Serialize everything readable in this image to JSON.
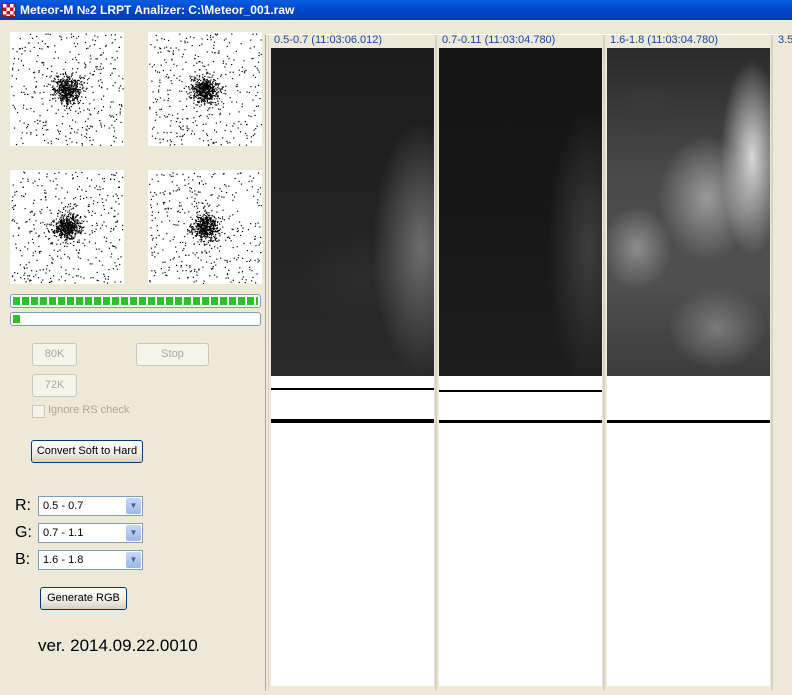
{
  "window": {
    "title": "Meteor-M №2 LRPT Analizer: C:\\Meteor_001.raw",
    "icon": "app-checker-icon"
  },
  "progress": {
    "signal_fraction": 1.0,
    "file_fraction": 0.03
  },
  "buttons": {
    "k80": "80K",
    "stop": "Stop",
    "k72": "72K",
    "convert": "Convert Soft to Hard",
    "generate": "Generate RGB"
  },
  "checkbox": {
    "ignore_rs": "Ignore RS check"
  },
  "rgb": {
    "r_label": "R:",
    "g_label": "G:",
    "b_label": "B:",
    "r_value": "0.5 - 0.7",
    "g_value": "0.7 - 1.1",
    "b_value": "1.6 - 1.8"
  },
  "version": "ver. 2014.09.22.0010",
  "channels": [
    {
      "label": "0.5-0.7 (11:03:06.012)"
    },
    {
      "label": "0.7-0.11 (11:03:04.780)"
    },
    {
      "label": "1.6-1.8 (11:03:04.780)"
    },
    {
      "label": "3.5"
    }
  ],
  "colors": {
    "titlebar": "#0054e3",
    "channel_label": "#1a46a8",
    "progress_green": "#2fbf2f",
    "window_bg": "#ece9d8"
  }
}
